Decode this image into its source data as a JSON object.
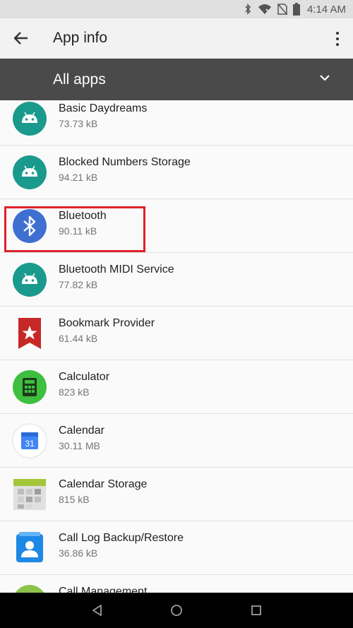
{
  "status_bar": {
    "time": "4:14 AM",
    "icons": [
      "bluetooth-icon",
      "wifi-icon",
      "no-sim-icon",
      "battery-icon"
    ]
  },
  "toolbar": {
    "title": "App info",
    "back_icon": "arrow-back-icon",
    "menu_icon": "more-vert-icon"
  },
  "filter": {
    "label": "All apps",
    "icon": "chevron-down-icon"
  },
  "apps": [
    {
      "name": "Basic Daydreams",
      "size": "73.73 kB",
      "icon": "android-icon"
    },
    {
      "name": "Blocked Numbers Storage",
      "size": "94.21 kB",
      "icon": "android-icon"
    },
    {
      "name": "Bluetooth",
      "size": "90.11 kB",
      "icon": "bluetooth-icon"
    },
    {
      "name": "Bluetooth MIDI Service",
      "size": "77.82 kB",
      "icon": "android-icon"
    },
    {
      "name": "Bookmark Provider",
      "size": "61.44 kB",
      "icon": "bookmark-icon"
    },
    {
      "name": "Calculator",
      "size": "823 kB",
      "icon": "calculator-icon"
    },
    {
      "name": "Calendar",
      "size": "30.11 MB",
      "icon": "calendar-icon"
    },
    {
      "name": "Calendar Storage",
      "size": "815 kB",
      "icon": "calendar-storage-icon"
    },
    {
      "name": "Call Log Backup/Restore",
      "size": "36.86 kB",
      "icon": "call-log-icon"
    },
    {
      "name": "Call Management",
      "size": "",
      "icon": "call-management-icon"
    }
  ],
  "calendar_day": "31",
  "highlighted_app": "Bluetooth",
  "colors": {
    "android_bg": "#1a9a8c",
    "bluetooth_bg": "#3f6fd1",
    "highlight_border": "#e0202a",
    "filter_bg": "#4a4a4a",
    "calculator_bg": "#3fbf3f"
  },
  "nav": {
    "back": "nav-back-icon",
    "home": "nav-home-icon",
    "recents": "nav-recents-icon"
  }
}
